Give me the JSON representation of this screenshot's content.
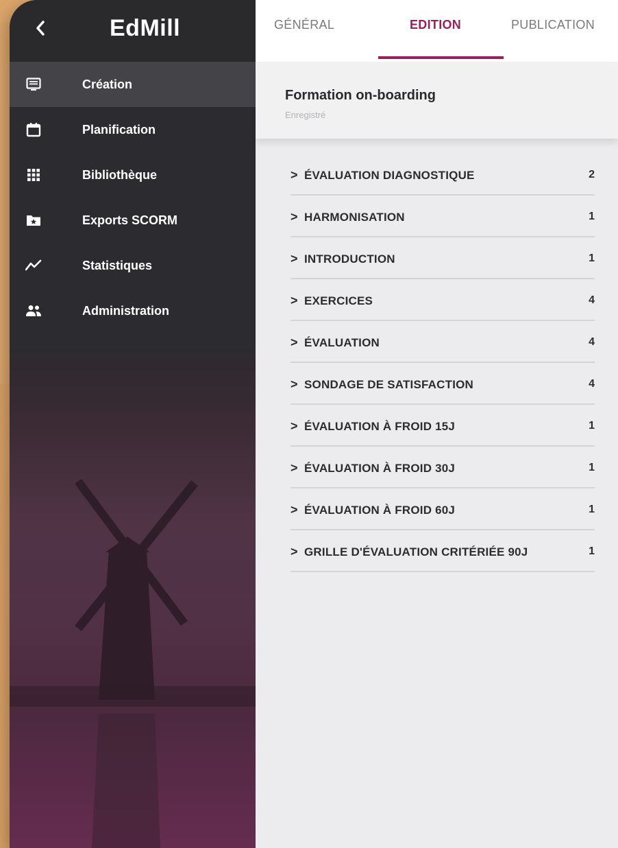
{
  "app": {
    "logo": "EdMill"
  },
  "sidebar": {
    "items": [
      {
        "label": "Création",
        "icon": "monitor-icon",
        "active": true
      },
      {
        "label": "Planification",
        "icon": "calendar-icon"
      },
      {
        "label": "Bibliothèque",
        "icon": "grid-icon"
      },
      {
        "label": "Exports SCORM",
        "icon": "folder-star-icon"
      },
      {
        "label": "Statistiques",
        "icon": "trend-line-icon"
      },
      {
        "label": "Administration",
        "icon": "people-icon"
      }
    ]
  },
  "tabs": [
    {
      "label": "GÉNÉRAL"
    },
    {
      "label": "EDITION",
      "active": true
    },
    {
      "label": "PUBLICATION"
    }
  ],
  "document": {
    "title": "Formation on-boarding",
    "status": "Enregistré"
  },
  "sections": [
    {
      "label": "ÉVALUATION DIAGNOSTIQUE",
      "count": "2"
    },
    {
      "label": "HARMONISATION",
      "count": "1"
    },
    {
      "label": "INTRODUCTION",
      "count": "1"
    },
    {
      "label": "EXERCICES",
      "count": "4"
    },
    {
      "label": "ÉVALUATION",
      "count": "4"
    },
    {
      "label": "SONDAGE DE SATISFACTION",
      "count": "4"
    },
    {
      "label": "ÉVALUATION À FROID 15J",
      "count": "1"
    },
    {
      "label": "ÉVALUATION À FROID 30J",
      "count": "1"
    },
    {
      "label": "ÉVALUATION À FROID 60J",
      "count": "1"
    },
    {
      "label": "GRILLE D'ÉVALUATION CRITÉRIÉE 90J",
      "count": "1"
    }
  ],
  "chevron": ">",
  "colors": {
    "accent": "#9b1f5c",
    "sidebar_bg": "#2c2b2f",
    "page_bg": "#ececee",
    "backdrop": "#dba56a"
  }
}
